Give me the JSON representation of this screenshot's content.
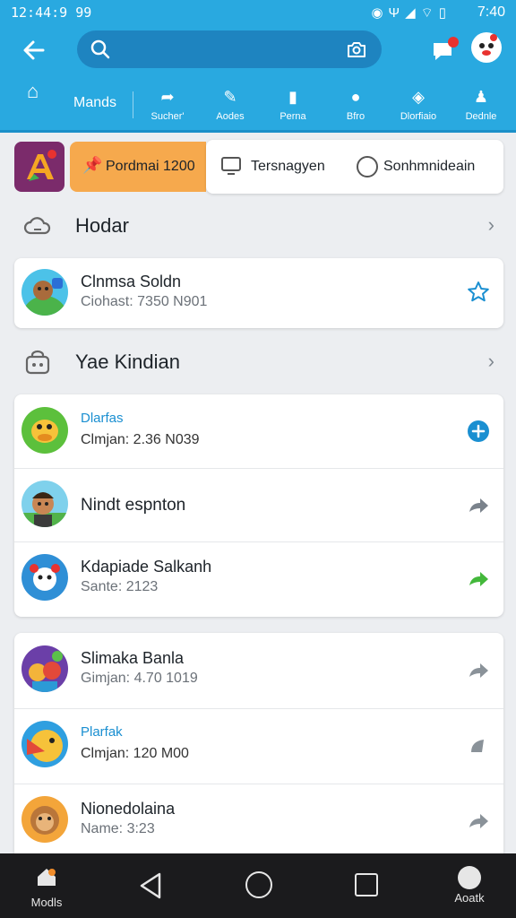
{
  "status_bar": {
    "time_left": "12:44:9 99",
    "time_right": "7:40"
  },
  "colors": {
    "brand": "#29a9e0",
    "search_bg": "#1e84c0",
    "chip_orange": "#f6a94d",
    "link_blue": "#1a8fd1",
    "nav_bg": "#1b1b1d"
  },
  "tabs": [
    {
      "label": "Mands",
      "icon": "home-icon"
    },
    {
      "label": "Sucher'",
      "icon": "share-icon"
    },
    {
      "label": "Aodes",
      "icon": "edit-icon"
    },
    {
      "label": "Perna",
      "icon": "book-icon"
    },
    {
      "label": "Bfro",
      "icon": "chat-icon"
    },
    {
      "label": "Dlorfiaio",
      "icon": "fish-icon"
    },
    {
      "label": "Dednle",
      "icon": "person-icon"
    }
  ],
  "chips": {
    "orange_label": "Pordmai 1200",
    "chip2_label": "Tersnagyen",
    "chip3_label": "Sonhmnideain"
  },
  "section1": {
    "title": "Hodar"
  },
  "section2": {
    "title": "Yae Kindian"
  },
  "card1": {
    "name": "Clnmsa Soldn",
    "sub": "Ciohast: 7350 N901"
  },
  "card2": [
    {
      "name": "Dlarfas",
      "sub": "Clmjan: 2.36 N039"
    },
    {
      "name": "Nindt espnton"
    },
    {
      "name": "Kdapiade Salkanh",
      "sub": "Sante: 2123"
    }
  ],
  "card3": [
    {
      "name": "Slimaka Banla",
      "sub": "Gimjan: 4.70 1019"
    },
    {
      "name": "Plarfak",
      "sub": "Clmjan: 120 M00"
    },
    {
      "name": "Nionedolaina",
      "sub": "Name: 3:23"
    }
  ],
  "bottom_nav": {
    "models_label": "Modls",
    "about_label": "Aoatk"
  }
}
